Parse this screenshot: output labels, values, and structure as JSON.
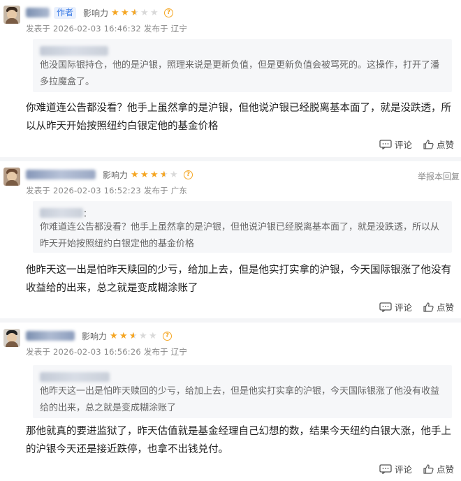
{
  "labels": {
    "author_tag": "作者",
    "influence": "影响力",
    "help": "?",
    "report": "举报本回复",
    "comment_btn": "评论",
    "like_btn": "点赞",
    "colon": "："
  },
  "colors": {
    "star_active": "#f5a623",
    "star_inactive": "#d9d9d9",
    "author_tag_text": "#3b7be5",
    "author_tag_bg": "#e9f0fd",
    "quote_bg": "#f6f7f9"
  },
  "comments": [
    {
      "rating": 2.5,
      "meta": "发表于 2026-02-03 16:46:32 发布于 辽宁",
      "quote": "他没国际银持仓，他的是沪银，照理来说是更新负值，但是更新负值会被骂死的。这操作，打开了潘多拉魔盒了。",
      "text": "你难道连公告都没看？他手上虽然拿的是沪银，但他说沪银已经脱离基本面了，就是没跌透，所以从昨天开始按照纽约白银定他的基金价格"
    },
    {
      "rating": 3.5,
      "meta": "发表于 2026-02-03 16:52:23 发布于 广东",
      "quote": "你难道连公告都没看？他手上虽然拿的是沪银，但他说沪银已经脱离基本面了，就是没跌透，所以从昨天开始按照纽约白银定他的基金价格",
      "text": "他昨天这一出是怕昨天赎回的少亏，给加上去，但是他实打实拿的沪银，今天国际银涨了他没有收益给的出来，总之就是变成糊涂账了"
    },
    {
      "rating": 2.5,
      "meta": "发表于 2026-02-03 16:56:26 发布于 辽宁",
      "quote": "他昨天这一出是怕昨天赎回的少亏，给加上去，但是他实打实拿的沪银，今天国际银涨了他没有收益给的出来，总之就是变成糊涂账了",
      "text": "那他就真的要进监狱了，昨天估值就是基金经理自己幻想的数，结果今天纽约白银大涨，他手上的沪银今天还是接近跌停，也拿不出钱兑付。"
    }
  ]
}
